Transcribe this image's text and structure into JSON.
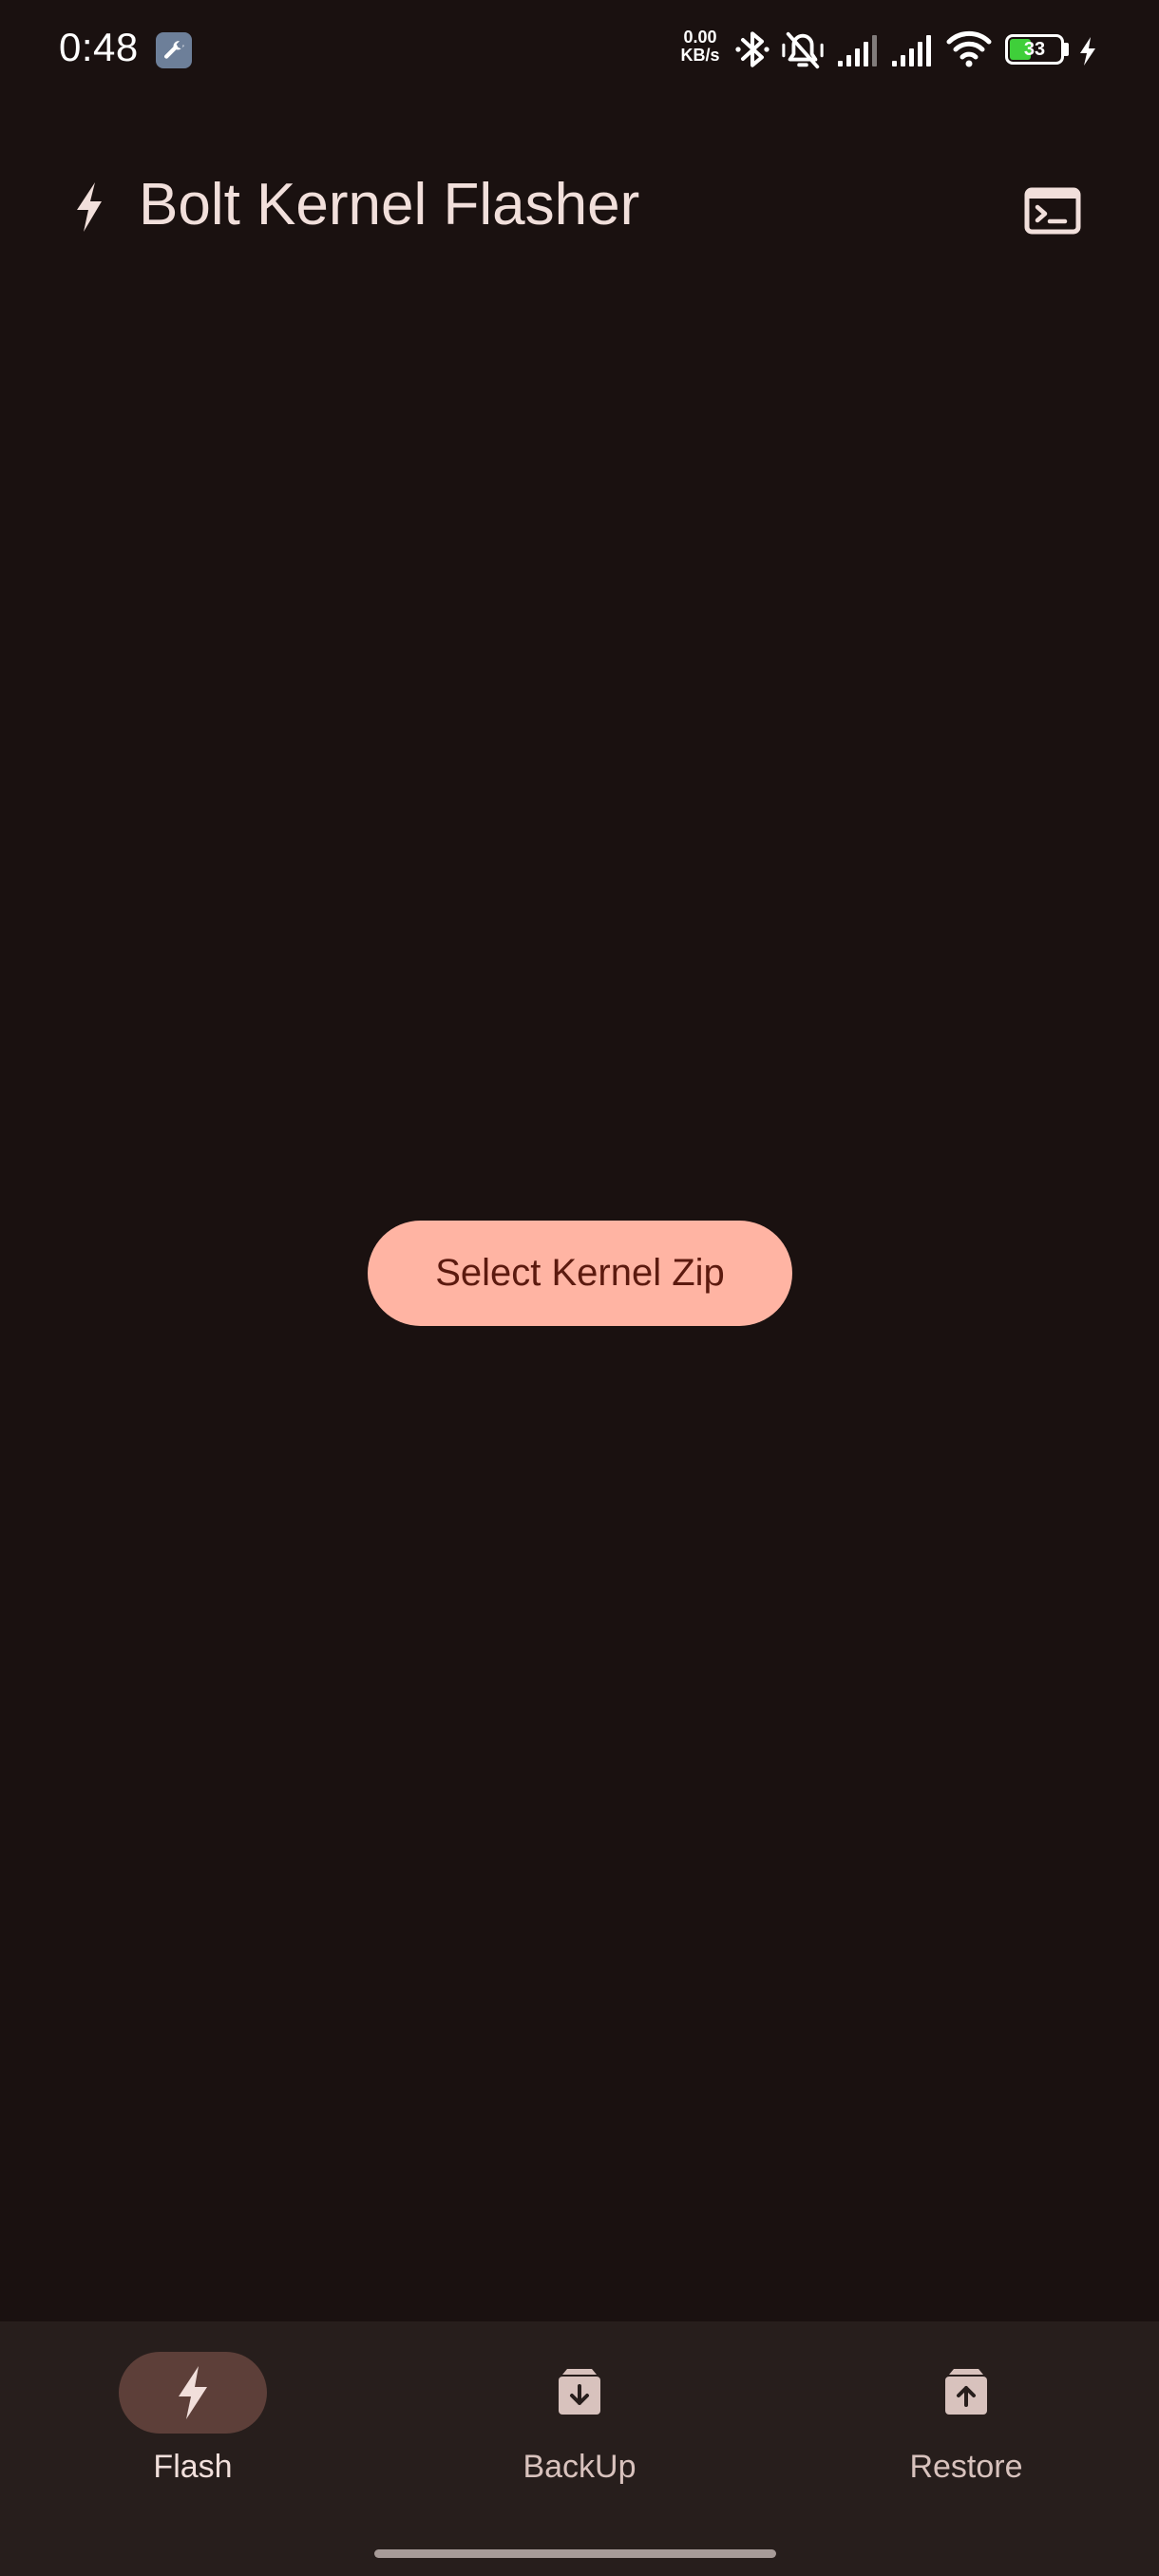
{
  "status_bar": {
    "time": "0:48",
    "net_speed_value": "0.00",
    "net_speed_unit": "KB/s",
    "battery_level": "33",
    "icons": [
      "wrench-icon",
      "bluetooth-icon",
      "mute-vibrate-icon",
      "signal-1-icon",
      "signal-2-icon",
      "wifi-icon",
      "battery-icon",
      "charging-icon"
    ]
  },
  "app_bar": {
    "title": "Bolt Kernel Flasher",
    "leading_icon": "bolt-icon",
    "action_icon": "terminal-icon"
  },
  "main": {
    "select_button_label": "Select Kernel Zip"
  },
  "bottom_nav": {
    "items": [
      {
        "label": "Flash",
        "icon": "bolt-icon",
        "active": true
      },
      {
        "label": "BackUp",
        "icon": "archive-down-icon",
        "active": false
      },
      {
        "label": "Restore",
        "icon": "archive-up-icon",
        "active": false
      }
    ]
  },
  "colors": {
    "background": "#1a1110",
    "nav_background": "#271e1c",
    "primary_button": "#ffb4a3",
    "active_pill": "#5d3f39",
    "battery_fill": "#3fcf3a"
  }
}
